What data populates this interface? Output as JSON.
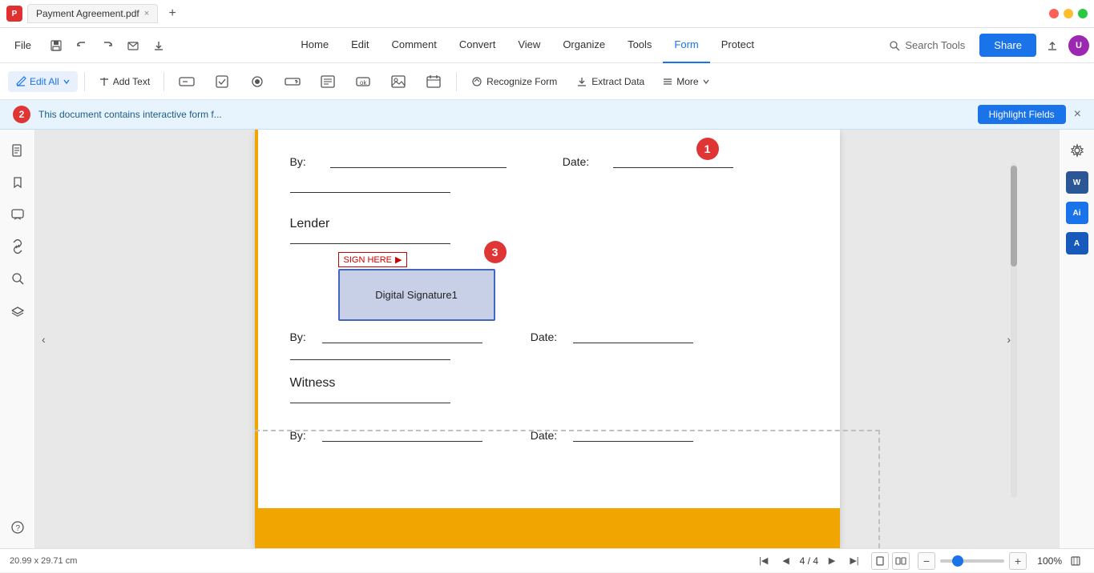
{
  "titlebar": {
    "app_icon_label": "P",
    "tab_title": "Payment Agreement.pdf",
    "tab_close": "×",
    "new_tab": "+"
  },
  "menubar": {
    "file_label": "File",
    "undo_icon": "↩",
    "redo_icon": "↪",
    "save_icon": "💾",
    "download_icon": "⬇",
    "nav_items": [
      {
        "label": "Home",
        "active": false
      },
      {
        "label": "Edit",
        "active": false
      },
      {
        "label": "Comment",
        "active": false
      },
      {
        "label": "Convert",
        "active": false
      },
      {
        "label": "View",
        "active": false
      },
      {
        "label": "Organize",
        "active": false
      },
      {
        "label": "Tools",
        "active": false
      },
      {
        "label": "Form",
        "active": true
      },
      {
        "label": "Protect",
        "active": false
      }
    ],
    "search_tools_label": "Search Tools",
    "share_label": "Share"
  },
  "toolbar": {
    "edit_all_label": "Edit All",
    "add_text_label": "Add Text",
    "recognize_form_label": "Recognize Form",
    "extract_data_label": "Extract Data",
    "more_label": "More"
  },
  "notification": {
    "text": "This document contains interactive form f...",
    "highlight_fields_label": "Highlight Fields",
    "step_badge": "2"
  },
  "document": {
    "by_label": "By:",
    "date_label": "Date:",
    "lender_label": "Lender",
    "sign_here_label": "SIGN HERE",
    "digital_sig_label": "Digital Signature1",
    "witness_label": "Witness",
    "step3_badge": "3"
  },
  "status_bar": {
    "dimensions": "20.99 x 29.71 cm",
    "page_info": "4 / 4",
    "zoom_level": "100%"
  },
  "steps": {
    "step1": "1",
    "step2": "2",
    "step3": "3"
  },
  "sidebar": {
    "icons": [
      "☰",
      "🔖",
      "💬",
      "🔗",
      "🔍",
      "⊞",
      "?"
    ]
  }
}
